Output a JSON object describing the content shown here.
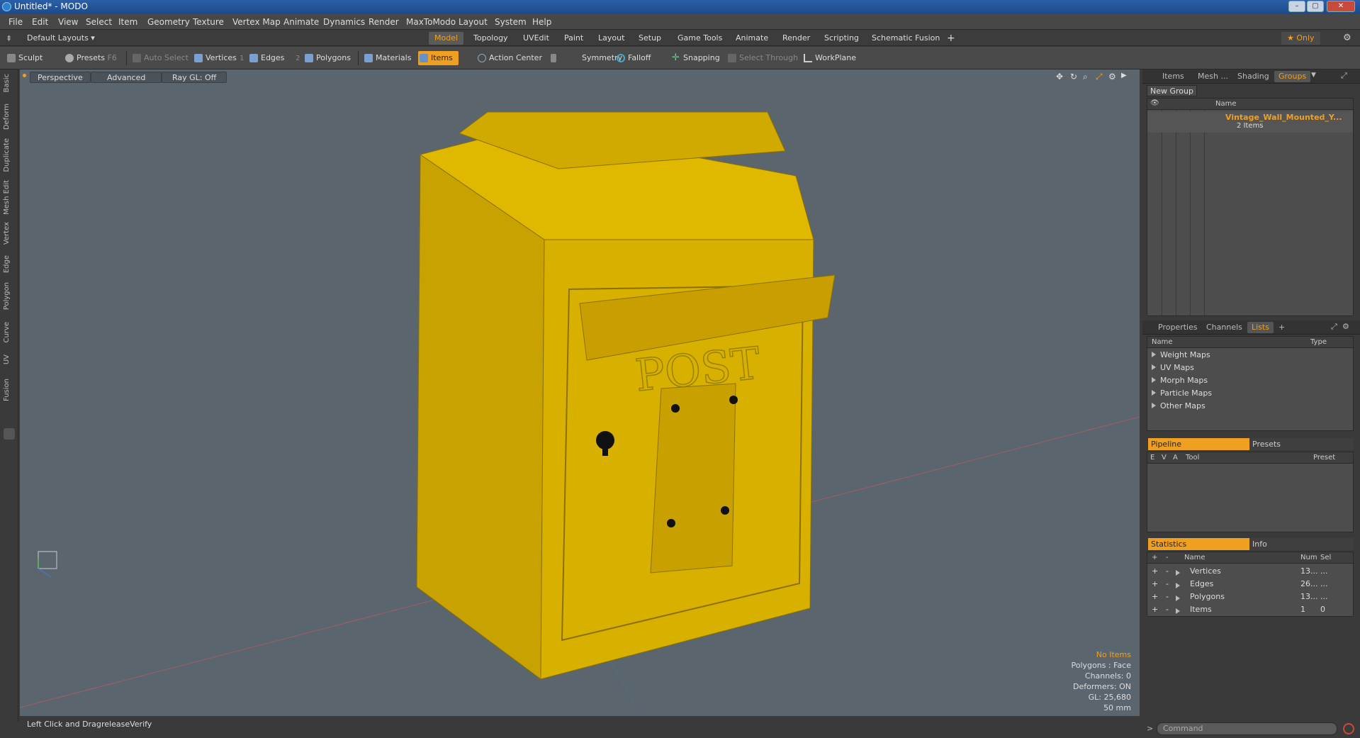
{
  "window": {
    "title": "Untitled* - MODO"
  },
  "menu": [
    "File",
    "Edit",
    "View",
    "Select",
    "Item",
    "Geometry",
    "Texture",
    "Vertex Map",
    "Animate",
    "Dynamics",
    "Render",
    "MaxToModo",
    "Layout",
    "System",
    "Help"
  ],
  "layout": {
    "selector": "Default Layouts ▾",
    "tabs": [
      "Model",
      "Topology",
      "UVEdit",
      "Paint",
      "Layout",
      "Setup",
      "Game Tools",
      "Animate",
      "Render",
      "Scripting",
      "Schematic Fusion"
    ],
    "add": "+",
    "only": "★ Only"
  },
  "toolbar": {
    "sculpt": "Sculpt",
    "presets": "Presets",
    "presets_key": "F6",
    "auto_select": "Auto Select",
    "vertices": "Vertices",
    "vertices_count": "1",
    "edges": "Edges",
    "edges_count": "2",
    "polygons": "Polygons",
    "materials": "Materials",
    "items": "Items",
    "action_center": "Action Center",
    "symmetry": "Symmetry",
    "falloff": "Falloff",
    "snapping": "Snapping",
    "select_through": "Select Through",
    "workplane": "WorkPlane"
  },
  "left_tabs": [
    "Basic",
    "Deform",
    "Duplicate",
    "Mesh Edit",
    "Vertex",
    "Edge",
    "Polygon",
    "Curve",
    "UV",
    "Fusion"
  ],
  "viewport": {
    "view": "Perspective",
    "mode": "Advanced",
    "raygl": "Ray GL: Off",
    "model_text": "POST",
    "info": {
      "no_items": "No Items",
      "polygons": "Polygons : Face",
      "channels": "Channels: 0",
      "deformers": "Deformers: ON",
      "gl": "GL: 25,680",
      "scale": "50 mm"
    }
  },
  "right_top": {
    "tabs": [
      "Items",
      "Mesh ...",
      "Shading",
      "Groups"
    ],
    "new_group": "New Group",
    "col_name": "Name",
    "group_name": "Vintage_Wall_Mounted_Y...",
    "group_sub": "2 Items"
  },
  "lists": {
    "tabs": [
      "Properties",
      "Channels",
      "Lists",
      "+"
    ],
    "col_name": "Name",
    "col_type": "Type",
    "items": [
      "Weight Maps",
      "UV Maps",
      "Morph Maps",
      "Particle Maps",
      "Other Maps"
    ]
  },
  "pipeline": {
    "tab_on": "Pipeline",
    "tab_off": "Presets",
    "cols": [
      "E",
      "V",
      "A",
      "Tool",
      "Preset"
    ]
  },
  "stats": {
    "tab_on": "Statistics",
    "tab_off": "Info",
    "cols": [
      "+",
      "-",
      "Name",
      "Num",
      "Sel"
    ],
    "rows": [
      {
        "name": "Vertices",
        "num": "13...",
        "sel": "..."
      },
      {
        "name": "Edges",
        "num": "26...",
        "sel": "..."
      },
      {
        "name": "Polygons",
        "num": "13...",
        "sel": "..."
      },
      {
        "name": "Items",
        "num": "1",
        "sel": "0"
      }
    ]
  },
  "status": {
    "hint": "Left Click and Drag:",
    "action": "releaseVerify"
  },
  "command": {
    "placeholder": "Command"
  },
  "colors": {
    "accent": "#f0a020",
    "model": "#d4a800",
    "viewport": "#5b656d"
  }
}
